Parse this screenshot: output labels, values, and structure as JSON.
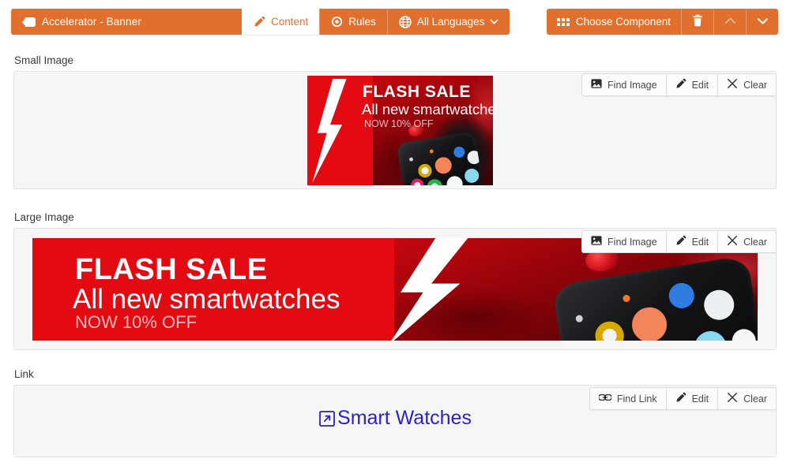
{
  "header": {
    "component_title": "Accelerator - Banner",
    "title_icon": "tag-icon",
    "tabs": [
      {
        "label": "Content",
        "icon": "pencil-icon",
        "active": true
      },
      {
        "label": "Rules",
        "icon": "eye-icon",
        "active": false
      },
      {
        "label": "All Languages",
        "icon": "globe-icon",
        "active": false,
        "has_caret": true
      }
    ],
    "choose_component_label": "Choose Component",
    "choose_component_icon": "grid-icon",
    "delete_icon": "trash-icon",
    "move_up_icon": "chevron-up-icon",
    "move_down_icon": "chevron-down-icon",
    "accent_color": "#e1702f",
    "tab_active_bg": "#ffffff"
  },
  "sections": {
    "small_image": {
      "label": "Small Image",
      "actions": [
        {
          "label": "Find Image",
          "icon": "image-icon"
        },
        {
          "label": "Edit",
          "icon": "pencil-icon"
        },
        {
          "label": "Clear",
          "icon": "close-icon"
        }
      ],
      "image": {
        "alt": "FLASH SALE banner - small",
        "line1": "FLASH SALE",
        "line2": "All new smartwatches",
        "line3": "NOW 10% OFF",
        "background_color": "#e40a12"
      }
    },
    "large_image": {
      "label": "Large Image",
      "actions": [
        {
          "label": "Find Image",
          "icon": "image-icon"
        },
        {
          "label": "Edit",
          "icon": "pencil-icon"
        },
        {
          "label": "Clear",
          "icon": "close-icon"
        }
      ],
      "image": {
        "alt": "FLASH SALE banner - large",
        "line1": "FLASH SALE",
        "line2": "All new smartwatches",
        "line3": "NOW 10% OFF",
        "background_color": "#e40a12"
      }
    },
    "link": {
      "label": "Link",
      "actions": [
        {
          "label": "Find Link",
          "icon": "link-icon"
        },
        {
          "label": "Edit",
          "icon": "pencil-icon"
        },
        {
          "label": "Clear",
          "icon": "close-icon"
        }
      ],
      "value": "Smart Watches",
      "value_icon": "external-link-icon",
      "value_color": "#2a22c8"
    }
  }
}
